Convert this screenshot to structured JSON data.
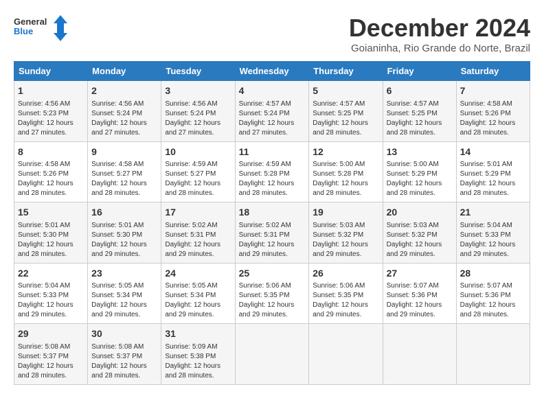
{
  "logo": {
    "line1": "General",
    "line2": "Blue"
  },
  "title": "December 2024",
  "subtitle": "Goianinha, Rio Grande do Norte, Brazil",
  "weekdays": [
    "Sunday",
    "Monday",
    "Tuesday",
    "Wednesday",
    "Thursday",
    "Friday",
    "Saturday"
  ],
  "weeks": [
    [
      {
        "day": "1",
        "info": "Sunrise: 4:56 AM\nSunset: 5:23 PM\nDaylight: 12 hours\nand 27 minutes."
      },
      {
        "day": "2",
        "info": "Sunrise: 4:56 AM\nSunset: 5:24 PM\nDaylight: 12 hours\nand 27 minutes."
      },
      {
        "day": "3",
        "info": "Sunrise: 4:56 AM\nSunset: 5:24 PM\nDaylight: 12 hours\nand 27 minutes."
      },
      {
        "day": "4",
        "info": "Sunrise: 4:57 AM\nSunset: 5:24 PM\nDaylight: 12 hours\nand 27 minutes."
      },
      {
        "day": "5",
        "info": "Sunrise: 4:57 AM\nSunset: 5:25 PM\nDaylight: 12 hours\nand 28 minutes."
      },
      {
        "day": "6",
        "info": "Sunrise: 4:57 AM\nSunset: 5:25 PM\nDaylight: 12 hours\nand 28 minutes."
      },
      {
        "day": "7",
        "info": "Sunrise: 4:58 AM\nSunset: 5:26 PM\nDaylight: 12 hours\nand 28 minutes."
      }
    ],
    [
      {
        "day": "8",
        "info": "Sunrise: 4:58 AM\nSunset: 5:26 PM\nDaylight: 12 hours\nand 28 minutes."
      },
      {
        "day": "9",
        "info": "Sunrise: 4:58 AM\nSunset: 5:27 PM\nDaylight: 12 hours\nand 28 minutes."
      },
      {
        "day": "10",
        "info": "Sunrise: 4:59 AM\nSunset: 5:27 PM\nDaylight: 12 hours\nand 28 minutes."
      },
      {
        "day": "11",
        "info": "Sunrise: 4:59 AM\nSunset: 5:28 PM\nDaylight: 12 hours\nand 28 minutes."
      },
      {
        "day": "12",
        "info": "Sunrise: 5:00 AM\nSunset: 5:28 PM\nDaylight: 12 hours\nand 28 minutes."
      },
      {
        "day": "13",
        "info": "Sunrise: 5:00 AM\nSunset: 5:29 PM\nDaylight: 12 hours\nand 28 minutes."
      },
      {
        "day": "14",
        "info": "Sunrise: 5:01 AM\nSunset: 5:29 PM\nDaylight: 12 hours\nand 28 minutes."
      }
    ],
    [
      {
        "day": "15",
        "info": "Sunrise: 5:01 AM\nSunset: 5:30 PM\nDaylight: 12 hours\nand 28 minutes."
      },
      {
        "day": "16",
        "info": "Sunrise: 5:01 AM\nSunset: 5:30 PM\nDaylight: 12 hours\nand 29 minutes."
      },
      {
        "day": "17",
        "info": "Sunrise: 5:02 AM\nSunset: 5:31 PM\nDaylight: 12 hours\nand 29 minutes."
      },
      {
        "day": "18",
        "info": "Sunrise: 5:02 AM\nSunset: 5:31 PM\nDaylight: 12 hours\nand 29 minutes."
      },
      {
        "day": "19",
        "info": "Sunrise: 5:03 AM\nSunset: 5:32 PM\nDaylight: 12 hours\nand 29 minutes."
      },
      {
        "day": "20",
        "info": "Sunrise: 5:03 AM\nSunset: 5:32 PM\nDaylight: 12 hours\nand 29 minutes."
      },
      {
        "day": "21",
        "info": "Sunrise: 5:04 AM\nSunset: 5:33 PM\nDaylight: 12 hours\nand 29 minutes."
      }
    ],
    [
      {
        "day": "22",
        "info": "Sunrise: 5:04 AM\nSunset: 5:33 PM\nDaylight: 12 hours\nand 29 minutes."
      },
      {
        "day": "23",
        "info": "Sunrise: 5:05 AM\nSunset: 5:34 PM\nDaylight: 12 hours\nand 29 minutes."
      },
      {
        "day": "24",
        "info": "Sunrise: 5:05 AM\nSunset: 5:34 PM\nDaylight: 12 hours\nand 29 minutes."
      },
      {
        "day": "25",
        "info": "Sunrise: 5:06 AM\nSunset: 5:35 PM\nDaylight: 12 hours\nand 29 minutes."
      },
      {
        "day": "26",
        "info": "Sunrise: 5:06 AM\nSunset: 5:35 PM\nDaylight: 12 hours\nand 29 minutes."
      },
      {
        "day": "27",
        "info": "Sunrise: 5:07 AM\nSunset: 5:36 PM\nDaylight: 12 hours\nand 29 minutes."
      },
      {
        "day": "28",
        "info": "Sunrise: 5:07 AM\nSunset: 5:36 PM\nDaylight: 12 hours\nand 28 minutes."
      }
    ],
    [
      {
        "day": "29",
        "info": "Sunrise: 5:08 AM\nSunset: 5:37 PM\nDaylight: 12 hours\nand 28 minutes."
      },
      {
        "day": "30",
        "info": "Sunrise: 5:08 AM\nSunset: 5:37 PM\nDaylight: 12 hours\nand 28 minutes."
      },
      {
        "day": "31",
        "info": "Sunrise: 5:09 AM\nSunset: 5:38 PM\nDaylight: 12 hours\nand 28 minutes."
      },
      {
        "day": "",
        "info": ""
      },
      {
        "day": "",
        "info": ""
      },
      {
        "day": "",
        "info": ""
      },
      {
        "day": "",
        "info": ""
      }
    ]
  ]
}
